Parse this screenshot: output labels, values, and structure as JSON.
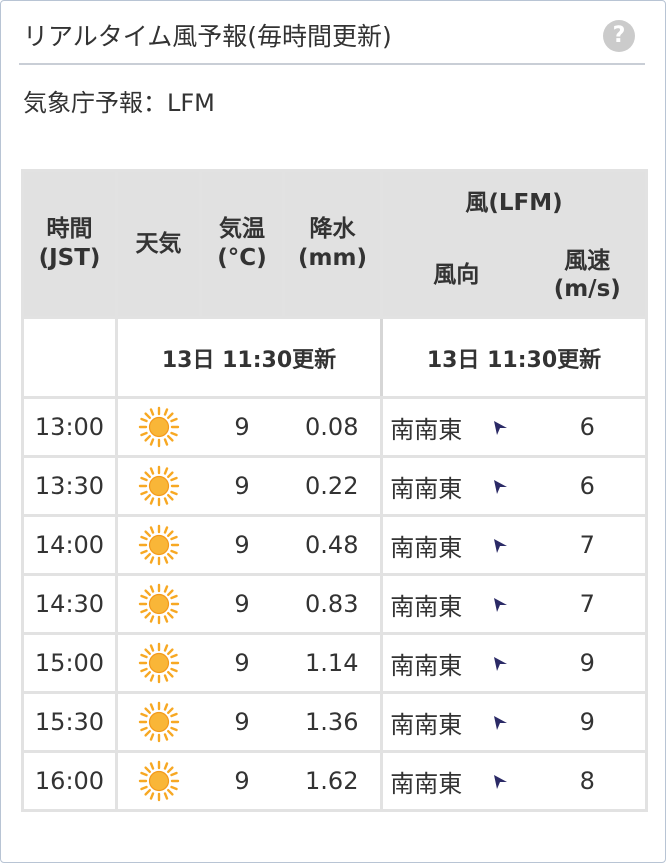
{
  "header": {
    "title": "リアルタイム風予報(毎時間更新)",
    "help_icon": "question-circle-icon"
  },
  "subtitle": "気象庁予報：LFM",
  "table": {
    "wind_group_header": "風(LFM)",
    "columns": {
      "time": "時間\n(JST)",
      "weather": "天気",
      "temp": "気温\n(°C)",
      "precip": "降水\n(mm)",
      "wind_dir": "風向",
      "wind_speed": "風速\n(m/s)"
    },
    "update_left": "13日 11:30更新",
    "update_right": "13日 11:30更新",
    "rows": [
      {
        "time": "13:00",
        "weather": "sunny-icon",
        "temp": "9",
        "precip": "0.08",
        "dir": "南南東",
        "dir_icon": "wind-arrow-icon",
        "speed": "6"
      },
      {
        "time": "13:30",
        "weather": "sunny-icon",
        "temp": "9",
        "precip": "0.22",
        "dir": "南南東",
        "dir_icon": "wind-arrow-icon",
        "speed": "6"
      },
      {
        "time": "14:00",
        "weather": "sunny-icon",
        "temp": "9",
        "precip": "0.48",
        "dir": "南南東",
        "dir_icon": "wind-arrow-icon",
        "speed": "7"
      },
      {
        "time": "14:30",
        "weather": "sunny-icon",
        "temp": "9",
        "precip": "0.83",
        "dir": "南南東",
        "dir_icon": "wind-arrow-icon",
        "speed": "7"
      },
      {
        "time": "15:00",
        "weather": "sunny-icon",
        "temp": "9",
        "precip": "1.14",
        "dir": "南南東",
        "dir_icon": "wind-arrow-icon",
        "speed": "9"
      },
      {
        "time": "15:30",
        "weather": "sunny-icon",
        "temp": "9",
        "precip": "1.36",
        "dir": "南南東",
        "dir_icon": "wind-arrow-icon",
        "speed": "9"
      },
      {
        "time": "16:00",
        "weather": "sunny-icon",
        "temp": "9",
        "precip": "1.62",
        "dir": "南南東",
        "dir_icon": "wind-arrow-icon",
        "speed": "8"
      }
    ]
  },
  "colors": {
    "header_bg": "#e1e1e1",
    "border": "#e2e2e2",
    "sun": "#f7a823",
    "arrow": "#2b2a66",
    "help": "#cbcbcb"
  }
}
